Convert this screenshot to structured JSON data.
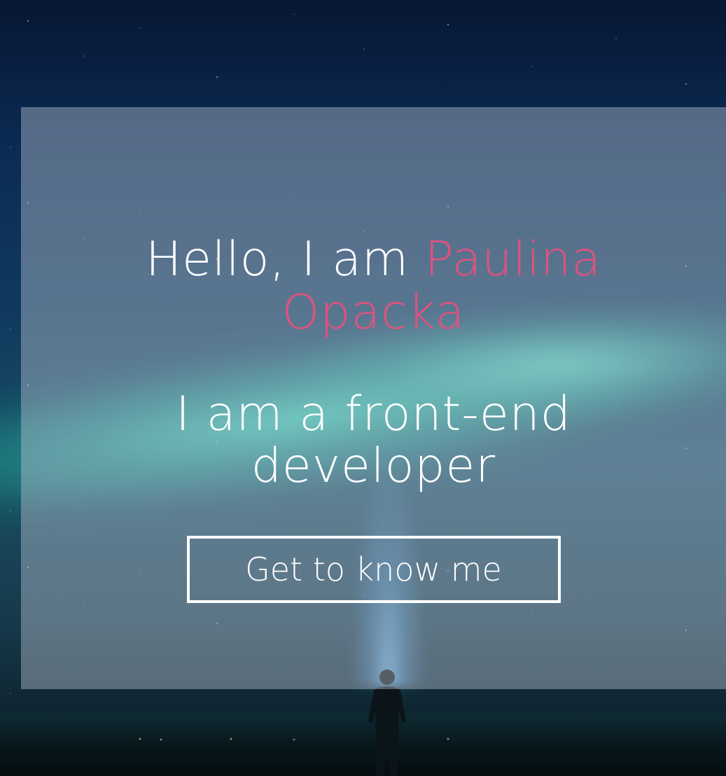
{
  "hero": {
    "greeting": "Hello, I am ",
    "name": "Paulina Opacka",
    "tagline": "I am a front-end developer",
    "cta_label": "Get to know me"
  },
  "colors": {
    "accent": "#e0527f",
    "text": "#ffffff"
  }
}
